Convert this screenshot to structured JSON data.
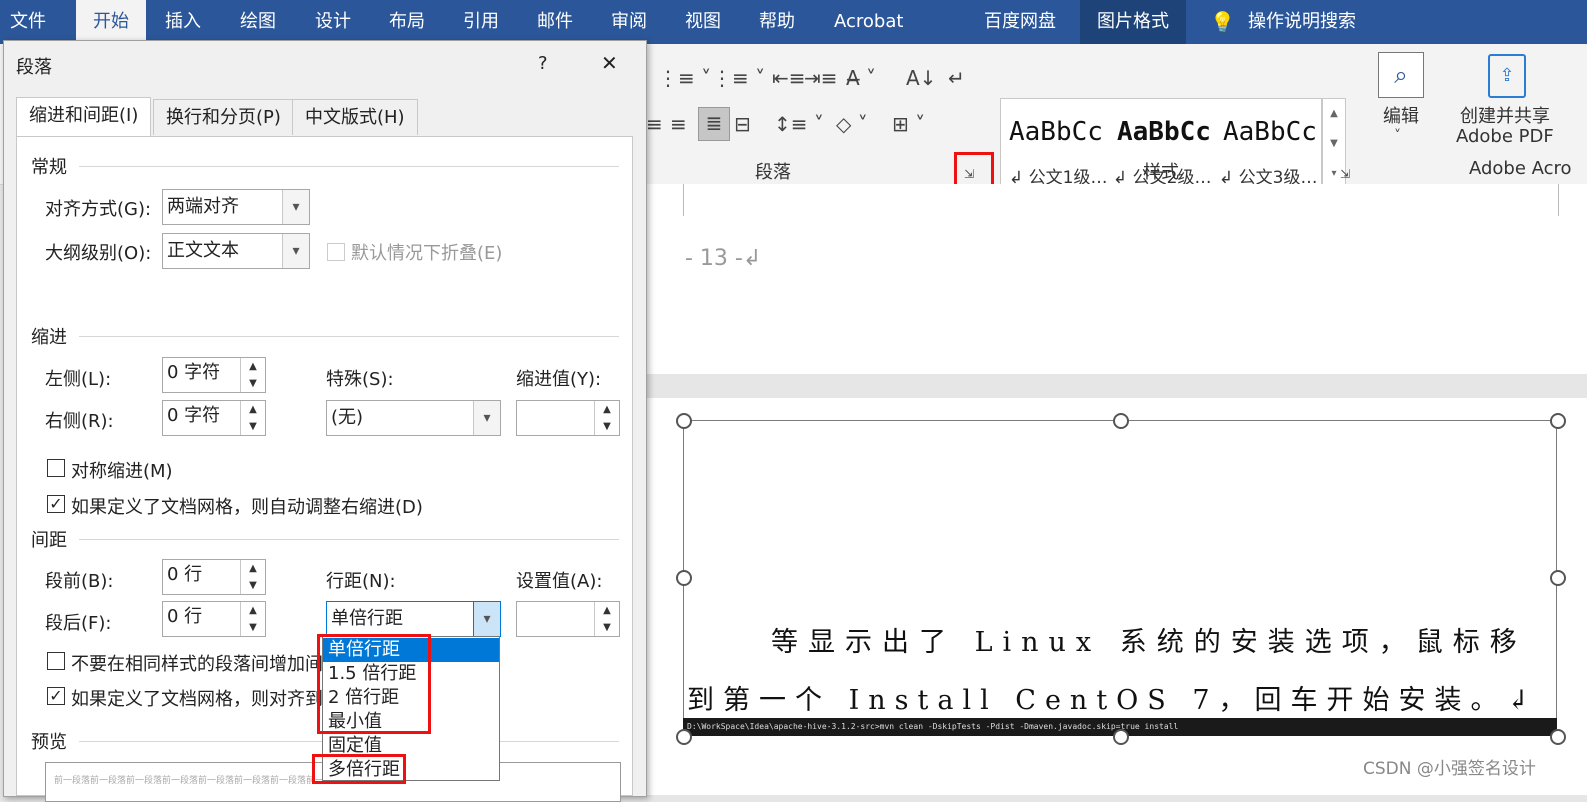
{
  "ribbon": {
    "tabs": [
      "文件",
      "开始",
      "插入",
      "绘图",
      "设计",
      "布局",
      "引用",
      "邮件",
      "审阅",
      "视图",
      "帮助",
      "Acrobat",
      "百度网盘",
      "图片格式",
      "操作说明搜索"
    ],
    "groups": {
      "paragraph": "段落",
      "styles": "样式",
      "adobe": "Adobe Acro"
    },
    "styles": [
      {
        "preview": "AaBbCc",
        "name": "↲ 公文1级…"
      },
      {
        "preview": "AaBbCc",
        "name": "↲ 公文2级…"
      },
      {
        "preview": "AaBbCc",
        "name": "↲ 公文3级…"
      }
    ],
    "edit_label": "编辑",
    "pdf_label_1": "创建并共享",
    "pdf_label_2": "Adobe PDF"
  },
  "document": {
    "page_number": "- 13 -↲",
    "body_line1": "等显示出了 Linux 系统的安装选项，鼠标移",
    "body_line2": "到第一个 Install CentOS 7，回车开始安装。↲",
    "console": "D:\\WorkSpace\\Idea\\apache-hive-3.1.2-src>mvn clean -DskipTests -Pdist -Dmaven.javadoc.skip=true install",
    "watermark": "CSDN @小强签名设计"
  },
  "dialog": {
    "title": "段落",
    "help": "?",
    "close": "✕",
    "tabs": [
      "缩进和间距(I)",
      "换行和分页(P)",
      "中文版式(H)"
    ],
    "general": {
      "heading": "常规",
      "align_label": "对齐方式(G):",
      "align_value": "两端对齐",
      "outline_label": "大纲级别(O):",
      "outline_value": "正文文本",
      "collapse_label": "默认情况下折叠(E)"
    },
    "indent": {
      "heading": "缩进",
      "left_label": "左侧(L):",
      "left_value": "0 字符",
      "right_label": "右侧(R):",
      "right_value": "0 字符",
      "special_label": "特殊(S):",
      "special_value": "(无)",
      "by_label": "缩进值(Y):",
      "mirror_label": "对称缩进(M)",
      "auto_right_label": "如果定义了文档网格，则自动调整右缩进(D)"
    },
    "spacing": {
      "heading": "间距",
      "before_label": "段前(B):",
      "before_value": "0 行",
      "after_label": "段后(F):",
      "after_value": "0 行",
      "line_label": "行距(N):",
      "line_value": "单倍行距",
      "at_label": "设置值(A):",
      "no_space_label": "不要在相同样式的段落间增加间距",
      "snap_label": "如果定义了文档网格，则对齐到网"
    },
    "preview": {
      "heading": "预览",
      "text": "前一段落前一段落前一段落前一段落前一段落前一段落前一段落前一段落前一段落前一段"
    },
    "line_spacing_options": [
      "单倍行距",
      "1.5 倍行距",
      "2 倍行距",
      "最小值",
      "固定值",
      "多倍行距"
    ]
  }
}
